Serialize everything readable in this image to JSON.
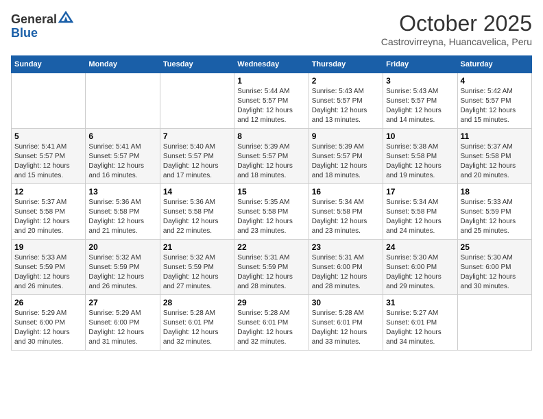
{
  "header": {
    "logo_line1": "General",
    "logo_line2": "Blue",
    "month": "October 2025",
    "location": "Castrovirreyna, Huancavelica, Peru"
  },
  "weekdays": [
    "Sunday",
    "Monday",
    "Tuesday",
    "Wednesday",
    "Thursday",
    "Friday",
    "Saturday"
  ],
  "weeks": [
    [
      {
        "day": "",
        "info": ""
      },
      {
        "day": "",
        "info": ""
      },
      {
        "day": "",
        "info": ""
      },
      {
        "day": "1",
        "info": "Sunrise: 5:44 AM\nSunset: 5:57 PM\nDaylight: 12 hours\nand 12 minutes."
      },
      {
        "day": "2",
        "info": "Sunrise: 5:43 AM\nSunset: 5:57 PM\nDaylight: 12 hours\nand 13 minutes."
      },
      {
        "day": "3",
        "info": "Sunrise: 5:43 AM\nSunset: 5:57 PM\nDaylight: 12 hours\nand 14 minutes."
      },
      {
        "day": "4",
        "info": "Sunrise: 5:42 AM\nSunset: 5:57 PM\nDaylight: 12 hours\nand 15 minutes."
      }
    ],
    [
      {
        "day": "5",
        "info": "Sunrise: 5:41 AM\nSunset: 5:57 PM\nDaylight: 12 hours\nand 15 minutes."
      },
      {
        "day": "6",
        "info": "Sunrise: 5:41 AM\nSunset: 5:57 PM\nDaylight: 12 hours\nand 16 minutes."
      },
      {
        "day": "7",
        "info": "Sunrise: 5:40 AM\nSunset: 5:57 PM\nDaylight: 12 hours\nand 17 minutes."
      },
      {
        "day": "8",
        "info": "Sunrise: 5:39 AM\nSunset: 5:57 PM\nDaylight: 12 hours\nand 18 minutes."
      },
      {
        "day": "9",
        "info": "Sunrise: 5:39 AM\nSunset: 5:57 PM\nDaylight: 12 hours\nand 18 minutes."
      },
      {
        "day": "10",
        "info": "Sunrise: 5:38 AM\nSunset: 5:58 PM\nDaylight: 12 hours\nand 19 minutes."
      },
      {
        "day": "11",
        "info": "Sunrise: 5:37 AM\nSunset: 5:58 PM\nDaylight: 12 hours\nand 20 minutes."
      }
    ],
    [
      {
        "day": "12",
        "info": "Sunrise: 5:37 AM\nSunset: 5:58 PM\nDaylight: 12 hours\nand 20 minutes."
      },
      {
        "day": "13",
        "info": "Sunrise: 5:36 AM\nSunset: 5:58 PM\nDaylight: 12 hours\nand 21 minutes."
      },
      {
        "day": "14",
        "info": "Sunrise: 5:36 AM\nSunset: 5:58 PM\nDaylight: 12 hours\nand 22 minutes."
      },
      {
        "day": "15",
        "info": "Sunrise: 5:35 AM\nSunset: 5:58 PM\nDaylight: 12 hours\nand 23 minutes."
      },
      {
        "day": "16",
        "info": "Sunrise: 5:34 AM\nSunset: 5:58 PM\nDaylight: 12 hours\nand 23 minutes."
      },
      {
        "day": "17",
        "info": "Sunrise: 5:34 AM\nSunset: 5:58 PM\nDaylight: 12 hours\nand 24 minutes."
      },
      {
        "day": "18",
        "info": "Sunrise: 5:33 AM\nSunset: 5:59 PM\nDaylight: 12 hours\nand 25 minutes."
      }
    ],
    [
      {
        "day": "19",
        "info": "Sunrise: 5:33 AM\nSunset: 5:59 PM\nDaylight: 12 hours\nand 26 minutes."
      },
      {
        "day": "20",
        "info": "Sunrise: 5:32 AM\nSunset: 5:59 PM\nDaylight: 12 hours\nand 26 minutes."
      },
      {
        "day": "21",
        "info": "Sunrise: 5:32 AM\nSunset: 5:59 PM\nDaylight: 12 hours\nand 27 minutes."
      },
      {
        "day": "22",
        "info": "Sunrise: 5:31 AM\nSunset: 5:59 PM\nDaylight: 12 hours\nand 28 minutes."
      },
      {
        "day": "23",
        "info": "Sunrise: 5:31 AM\nSunset: 6:00 PM\nDaylight: 12 hours\nand 28 minutes."
      },
      {
        "day": "24",
        "info": "Sunrise: 5:30 AM\nSunset: 6:00 PM\nDaylight: 12 hours\nand 29 minutes."
      },
      {
        "day": "25",
        "info": "Sunrise: 5:30 AM\nSunset: 6:00 PM\nDaylight: 12 hours\nand 30 minutes."
      }
    ],
    [
      {
        "day": "26",
        "info": "Sunrise: 5:29 AM\nSunset: 6:00 PM\nDaylight: 12 hours\nand 30 minutes."
      },
      {
        "day": "27",
        "info": "Sunrise: 5:29 AM\nSunset: 6:00 PM\nDaylight: 12 hours\nand 31 minutes."
      },
      {
        "day": "28",
        "info": "Sunrise: 5:28 AM\nSunset: 6:01 PM\nDaylight: 12 hours\nand 32 minutes."
      },
      {
        "day": "29",
        "info": "Sunrise: 5:28 AM\nSunset: 6:01 PM\nDaylight: 12 hours\nand 32 minutes."
      },
      {
        "day": "30",
        "info": "Sunrise: 5:28 AM\nSunset: 6:01 PM\nDaylight: 12 hours\nand 33 minutes."
      },
      {
        "day": "31",
        "info": "Sunrise: 5:27 AM\nSunset: 6:01 PM\nDaylight: 12 hours\nand 34 minutes."
      },
      {
        "day": "",
        "info": ""
      }
    ]
  ]
}
